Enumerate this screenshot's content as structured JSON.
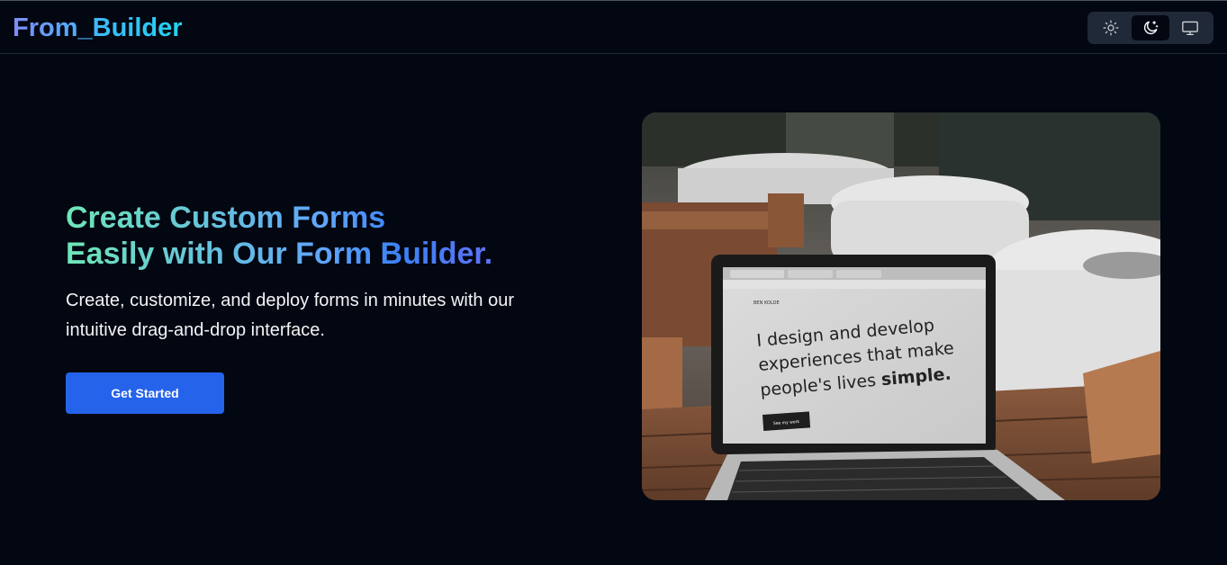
{
  "brand": {
    "name": "From_Builder"
  },
  "theme_toggle": {
    "options": [
      {
        "icon": "sun-icon",
        "label": "light"
      },
      {
        "icon": "moon-stars-icon",
        "label": "dark",
        "active": true
      },
      {
        "icon": "monitor-icon",
        "label": "system"
      }
    ]
  },
  "hero": {
    "title_line1": "Create Custom Forms",
    "title_line2": "Easily with Our Form Builder.",
    "subtitle": "Create, customize, and deploy forms in minutes with our intuitive drag-and-drop interface.",
    "cta_label": "Get Started",
    "image": {
      "screen_brand": "BEN KOLDE",
      "screen_line1": "I design and develop",
      "screen_line2": "experiences that make",
      "screen_line3_prefix": "people's lives ",
      "screen_line3_bold": "simple.",
      "screen_button": "See my work"
    }
  },
  "colors": {
    "background": "#030712",
    "accent": "#2563eb",
    "toggle_bg": "#1f2937"
  }
}
